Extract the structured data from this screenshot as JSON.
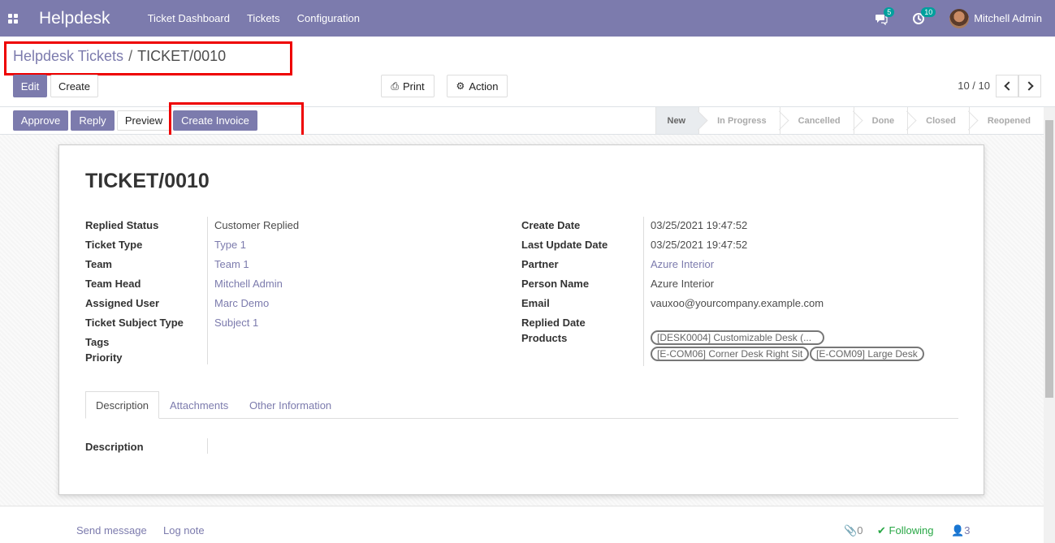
{
  "navbar": {
    "brand": "Helpdesk",
    "menu": [
      "Ticket Dashboard",
      "Tickets",
      "Configuration"
    ],
    "messages_badge": "5",
    "activities_badge": "10",
    "user": "Mitchell Admin"
  },
  "breadcrumb": {
    "parent": "Helpdesk Tickets",
    "separator": "/",
    "current": "TICKET/0010"
  },
  "toolbar": {
    "edit": "Edit",
    "create": "Create",
    "print": "Print",
    "action": "Action",
    "pager": "10 / 10"
  },
  "statusbar": {
    "buttons": [
      "Approve",
      "Reply",
      "Preview",
      "Create Invoice"
    ],
    "stages": [
      "New",
      "In Progress",
      "Cancelled",
      "Done",
      "Closed",
      "Reopened"
    ],
    "active_stage": "New"
  },
  "form": {
    "title": "TICKET/0010",
    "left": [
      {
        "label": "Replied Status",
        "value": "Customer Replied",
        "link": false
      },
      {
        "label": "Ticket Type",
        "value": "Type 1",
        "link": true
      },
      {
        "label": "Team",
        "value": "Team 1",
        "link": true
      },
      {
        "label": "Team Head",
        "value": "Mitchell Admin",
        "link": true
      },
      {
        "label": "Assigned User",
        "value": "Marc Demo",
        "link": true
      },
      {
        "label": "Ticket Subject Type",
        "value": "Subject 1",
        "link": true
      },
      {
        "label": "Tags",
        "value": "",
        "link": false
      },
      {
        "label": "Priority",
        "value": "",
        "link": false
      }
    ],
    "right": [
      {
        "label": "Create Date",
        "value": "03/25/2021 19:47:52",
        "link": false
      },
      {
        "label": "Last Update Date",
        "value": "03/25/2021 19:47:52",
        "link": false
      },
      {
        "label": "Partner",
        "value": "Azure Interior",
        "link": true
      },
      {
        "label": "Person Name",
        "value": "Azure Interior",
        "link": false
      },
      {
        "label": "Email",
        "value": "vauxoo@yourcompany.example.com",
        "link": false
      },
      {
        "label": "Replied Date",
        "value": "",
        "link": false
      },
      {
        "label": "Products",
        "value": "",
        "link": false
      }
    ],
    "products": [
      "[DESK0004] Customizable Desk (...",
      "[E-COM06] Corner Desk Right Sit",
      "[E-COM09] Large Desk"
    ],
    "tabs": [
      "Description",
      "Attachments",
      "Other Information"
    ],
    "description_label": "Description"
  },
  "chatter": {
    "send": "Send message",
    "log": "Log note",
    "attachments": "0",
    "following": "Following",
    "followers": "3"
  }
}
